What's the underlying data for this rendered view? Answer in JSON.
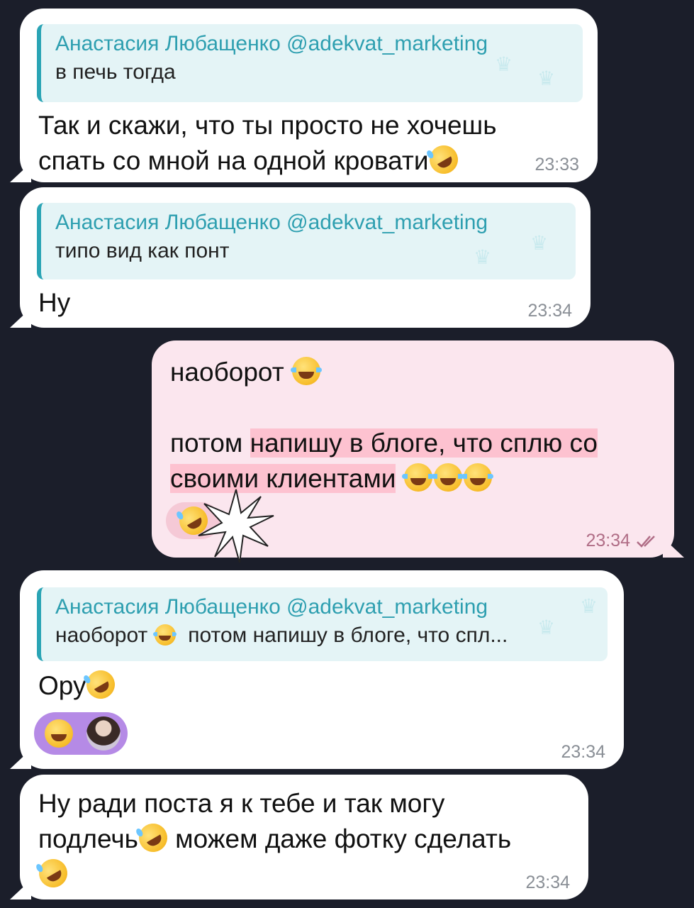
{
  "messages": [
    {
      "reply_name": "Анастасия Любащенко @adekvat_marketing",
      "reply_text": "в печь тогда",
      "text_line1": "Так и скажи, что ты просто не хочешь",
      "text_line2": "спать со мной на одной кровати",
      "time": "23:33"
    },
    {
      "reply_name": "Анастасия Любащенко @adekvat_marketing",
      "reply_text": "типо вид как понт",
      "text": "Ну",
      "time": "23:34"
    },
    {
      "line1": "наоборот",
      "line2a": "потом ",
      "line2b": "напишу в блоге, что сплю со",
      "line3": "своими клиентами",
      "time": "23:34"
    },
    {
      "reply_name": "Анастасия Любащенко @adekvat_marketing",
      "reply_text_a": "наоборот",
      "reply_text_b": "потом напишу в блоге, что спл...",
      "text": "Ору",
      "time": "23:34"
    },
    {
      "text_line1": "Ну ради поста я к тебе и так могу",
      "text_line2a": "подлечь",
      "text_line2b": " можем даже фотку сделать",
      "time": "23:34"
    }
  ],
  "colors": {
    "background": "#1b1e2a",
    "incoming": "#ffffff",
    "outgoing": "#fbe6ee",
    "reply_accent": "#2aa4b5",
    "reaction_purple": "#b58ae6"
  },
  "icons": [
    "rofl-emoji",
    "joy-emoji",
    "grin-emoji",
    "double-check-icon",
    "crown-icon"
  ]
}
